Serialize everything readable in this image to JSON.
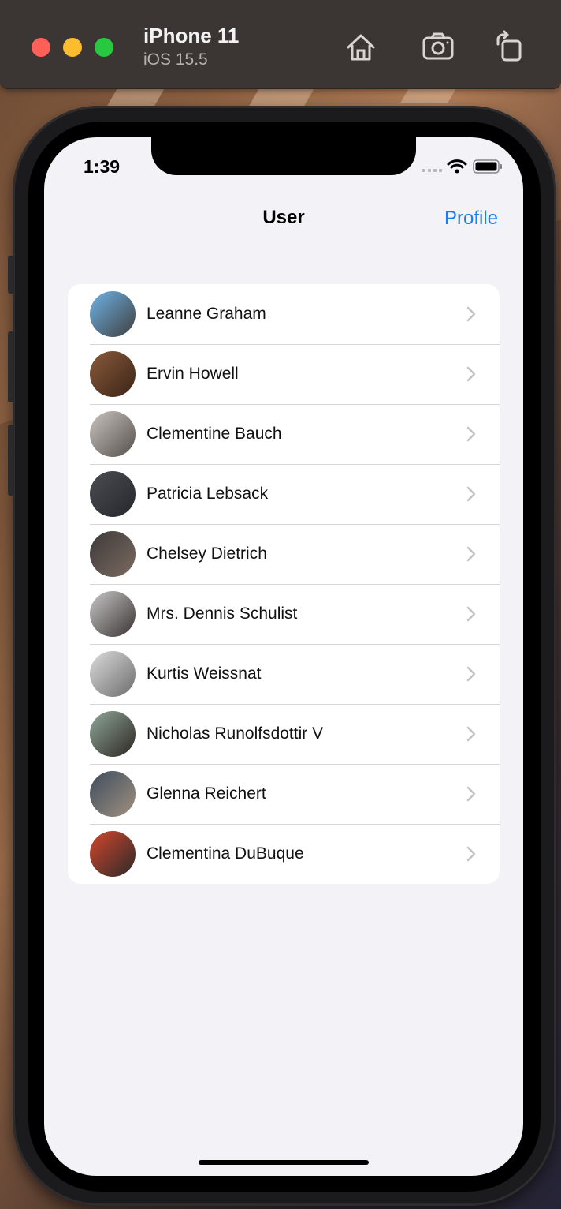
{
  "simulator": {
    "device_name": "iPhone 11",
    "os_version": "iOS 15.5",
    "toolbar_icons": [
      "home-icon",
      "screenshot-icon",
      "rotate-icon"
    ]
  },
  "status_bar": {
    "time": "1:39",
    "icons": [
      "cellular-icon",
      "wifi-icon",
      "battery-icon"
    ]
  },
  "nav": {
    "title": "User",
    "right_button": "Profile"
  },
  "users": [
    {
      "name": "Leanne Graham",
      "avatar_colors": [
        "#6fb3e6",
        "#3f3f3f"
      ]
    },
    {
      "name": "Ervin Howell",
      "avatar_colors": [
        "#8a5a3a",
        "#3a2418"
      ]
    },
    {
      "name": "Clementine Bauch",
      "avatar_colors": [
        "#c9c4be",
        "#55504c"
      ]
    },
    {
      "name": "Patricia Lebsack",
      "avatar_colors": [
        "#4a4d52",
        "#25272b"
      ]
    },
    {
      "name": "Chelsey Dietrich",
      "avatar_colors": [
        "#3d3a3a",
        "#7b6a60"
      ]
    },
    {
      "name": "Mrs. Dennis Schulist",
      "avatar_colors": [
        "#c8c8c8",
        "#3a3232"
      ]
    },
    {
      "name": "Kurtis Weissnat",
      "avatar_colors": [
        "#dcdcdc",
        "#6c6c6c"
      ]
    },
    {
      "name": "Nicholas Runolfsdottir V",
      "avatar_colors": [
        "#8fa89a",
        "#2d2522"
      ]
    },
    {
      "name": "Glenna Reichert",
      "avatar_colors": [
        "#3e4d5e",
        "#a09080"
      ]
    },
    {
      "name": "Clementina DuBuque",
      "avatar_colors": [
        "#d4462c",
        "#2a2a2a"
      ]
    }
  ],
  "accent_color": "#1a7ff0"
}
